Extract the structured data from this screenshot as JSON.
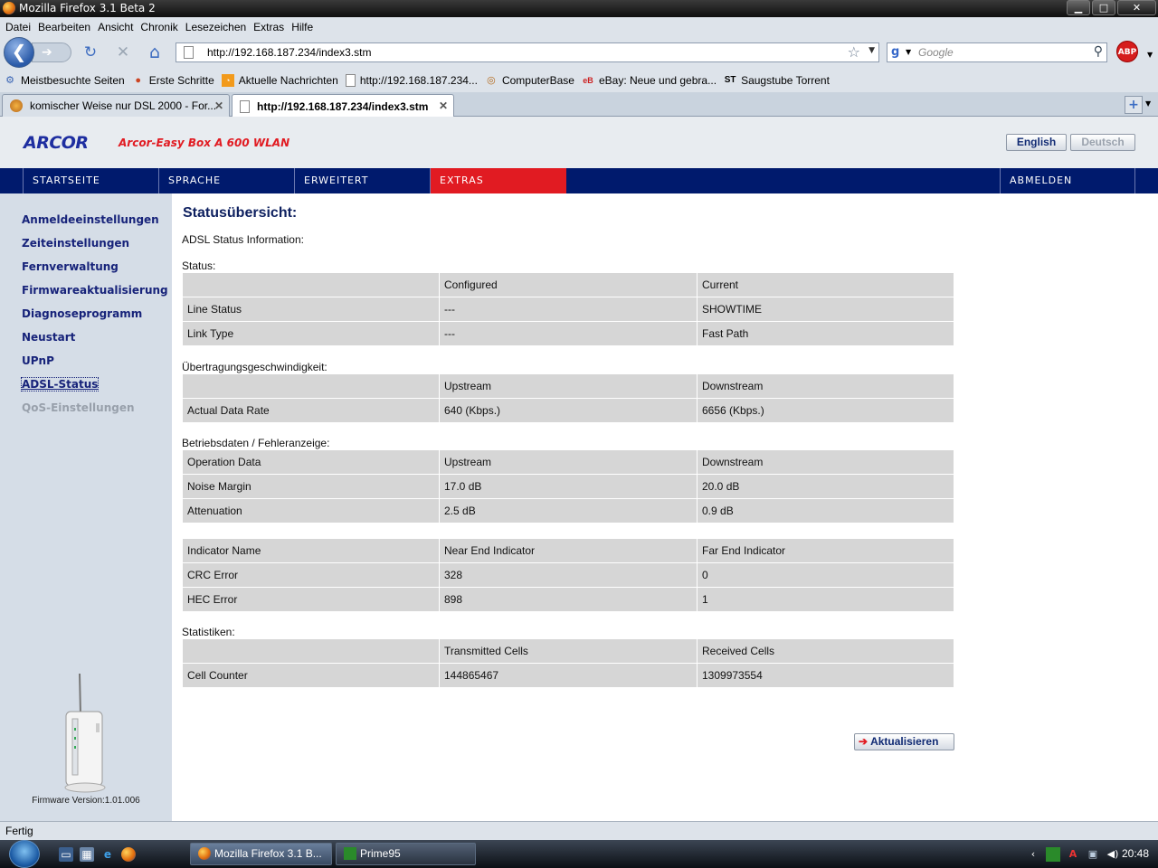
{
  "window": {
    "title": "Mozilla Firefox 3.1 Beta 2",
    "minimize": "▁",
    "maximize": "□",
    "close": "✕"
  },
  "menu": [
    "Datei",
    "Bearbeiten",
    "Ansicht",
    "Chronik",
    "Lesezeichen",
    "Extras",
    "Hilfe"
  ],
  "toolbar": {
    "url": "http://192.168.187.234/index3.stm",
    "search_placeholder": "Google",
    "abp_label": "ABP",
    "back_icon": "❮",
    "forward_icon": "➔",
    "reload_icon": "↻",
    "stop_icon": "✕",
    "home_icon": "⌂"
  },
  "bookmarks": [
    {
      "label": "Meistbesuchte Seiten",
      "icon": "gear-icon"
    },
    {
      "label": "Erste Schritte",
      "icon": "firefox-icon"
    },
    {
      "label": "Aktuelle Nachrichten",
      "icon": "rss-icon"
    },
    {
      "label": "http://192.168.187.234...",
      "icon": "page-icon"
    },
    {
      "label": "ComputerBase",
      "icon": "computerbase-icon"
    },
    {
      "label": "eBay: Neue und gebra...",
      "icon": "ebay-icon"
    },
    {
      "label": "Saugstube Torrent",
      "icon": "st-icon"
    }
  ],
  "tabs": [
    {
      "label": "komischer Weise nur DSL 2000 - For...",
      "active": false
    },
    {
      "label": "http://192.168.187.234/index3.stm",
      "active": true
    }
  ],
  "router_ui": {
    "brand": "ARCOR",
    "model": "Arcor-Easy Box A 600 WLAN",
    "lang_en": "English",
    "lang_de": "Deutsch",
    "nav": [
      "STARTSEITE",
      "SPRACHE",
      "ERWEITERT",
      "EXTRAS",
      "ABMELDEN"
    ],
    "nav_active": "EXTRAS",
    "sidebar": [
      "Anmeldeeinstellungen",
      "Zeiteinstellungen",
      "Fernverwaltung",
      "Firmwareaktualisierung",
      "Diagnoseprogramm",
      "Neustart",
      "UPnP",
      "ADSL-Status",
      "QoS-Einstellungen"
    ],
    "sidebar_current": "ADSL-Status",
    "sidebar_disabled": "QoS-Einstellungen",
    "firmware": "Firmware Version:1.01.006"
  },
  "main": {
    "heading": "Statusübersicht:",
    "subheading": "ADSL Status Information:",
    "status_label": "Status:",
    "status_table": [
      [
        "",
        "Configured",
        "Current"
      ],
      [
        "Line Status",
        "---",
        "SHOWTIME"
      ],
      [
        "Link Type",
        "---",
        "Fast Path"
      ]
    ],
    "speed_label": "Übertragungsgeschwindigkeit:",
    "speed_table": [
      [
        "",
        "Upstream",
        "Downstream"
      ],
      [
        "Actual Data Rate",
        "640 (Kbps.)",
        "6656 (Kbps.)"
      ]
    ],
    "ops_label": "Betriebsdaten / Fehleranzeige:",
    "ops_table": [
      [
        "Operation Data",
        "Upstream",
        "Downstream"
      ],
      [
        "Noise Margin",
        "17.0 dB",
        "20.0 dB"
      ],
      [
        "Attenuation",
        "2.5 dB",
        "0.9 dB"
      ]
    ],
    "indicator_table": [
      [
        "Indicator Name",
        "Near End Indicator",
        "Far End Indicator"
      ],
      [
        "CRC Error",
        "328",
        "0"
      ],
      [
        "HEC Error",
        "898",
        "1"
      ]
    ],
    "stats_label": "Statistiken:",
    "stats_table": [
      [
        "",
        "Transmitted Cells",
        "Received Cells"
      ],
      [
        "Cell Counter",
        "144865467",
        "1309973554"
      ]
    ],
    "refresh_label": "Aktualisieren",
    "refresh_arrow": "➔"
  },
  "status": "Fertig",
  "taskbar": {
    "tasks": [
      {
        "label": "Mozilla Firefox 3.1 B...",
        "active": true
      },
      {
        "label": "Prime95",
        "active": false
      }
    ],
    "clock": "20:48"
  }
}
